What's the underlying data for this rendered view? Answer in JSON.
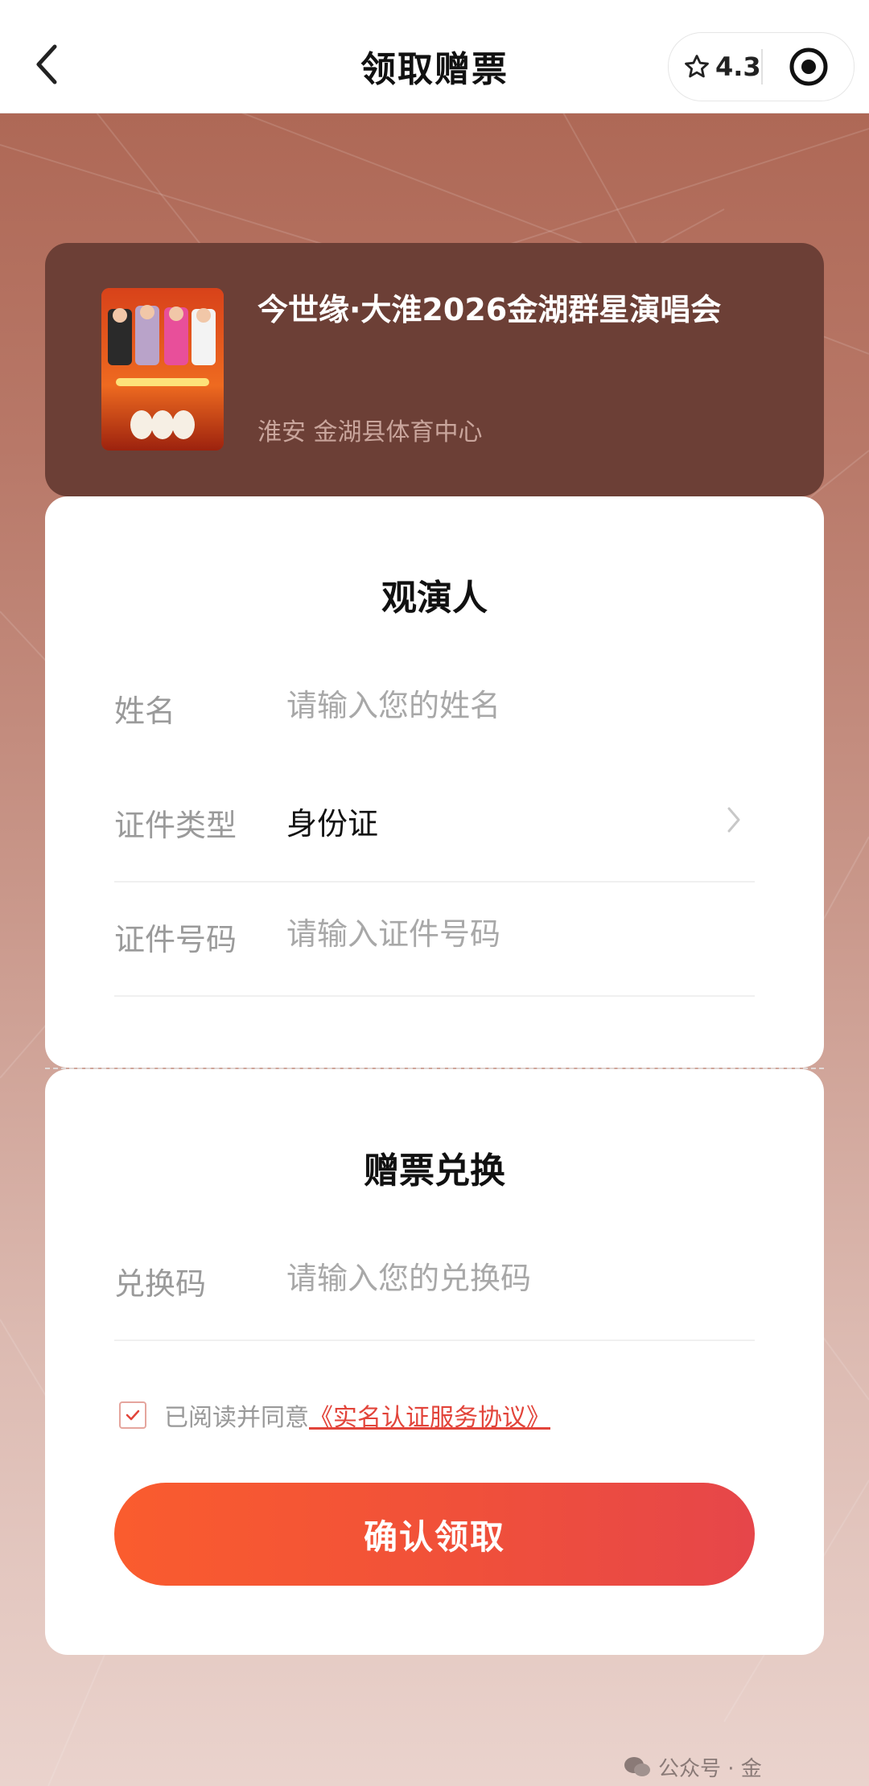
{
  "header": {
    "title": "领取赠票",
    "rating": "4.3",
    "icons": {
      "back": "chevron-left-icon",
      "star": "star-icon",
      "target": "target-icon"
    }
  },
  "event": {
    "title": "今世缘·大淮2026金湖群星演唱会",
    "venue": "淮安 金湖县体育中心"
  },
  "audience": {
    "section_title": "观演人",
    "name_label": "姓名",
    "name_placeholder": "请输入您的姓名",
    "id_type_label": "证件类型",
    "id_type_value": "身份证",
    "id_number_label": "证件号码",
    "id_number_placeholder": "请输入证件号码"
  },
  "redeem": {
    "section_title": "赠票兑换",
    "code_label": "兑换码",
    "code_placeholder": "请输入您的兑换码",
    "agree_text": "已阅读并同意",
    "agree_link": "《实名认证服务协议》",
    "agree_checked": true,
    "confirm_label": "确认领取"
  },
  "watermark": {
    "text": "公众号 · 金"
  },
  "colors": {
    "accent": "#f0503a",
    "event_card_bg": "#6c3f36",
    "link": "#e2443a"
  }
}
